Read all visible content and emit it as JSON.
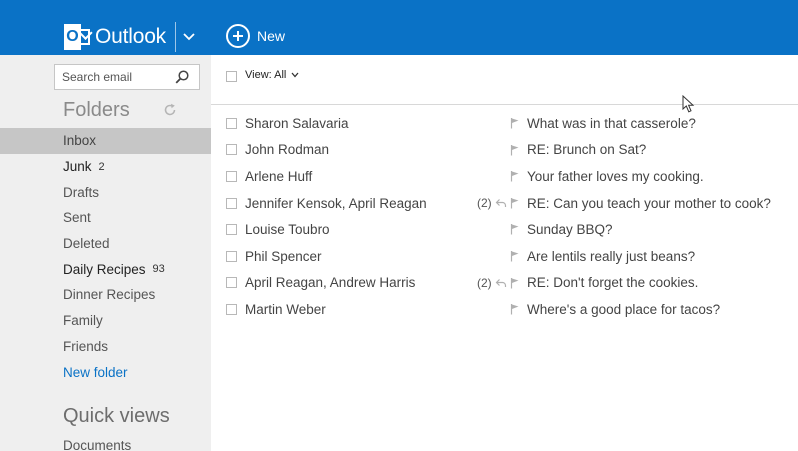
{
  "header": {
    "app_name": "Outlook",
    "new_label": "New",
    "brand_color": "#0a72c6"
  },
  "sidebar": {
    "search_placeholder": "Search email",
    "folders_title": "Folders",
    "folders": [
      {
        "label": "Inbox",
        "count": "",
        "state": "active"
      },
      {
        "label": "Junk",
        "count": "2",
        "state": "bold"
      },
      {
        "label": "Drafts",
        "count": "",
        "state": "normal"
      },
      {
        "label": "Sent",
        "count": "",
        "state": "normal"
      },
      {
        "label": "Deleted",
        "count": "",
        "state": "normal"
      },
      {
        "label": "Daily Recipes",
        "count": "93",
        "state": "bold"
      },
      {
        "label": "Dinner Recipes",
        "count": "",
        "state": "normal"
      },
      {
        "label": "Family",
        "count": "",
        "state": "normal"
      },
      {
        "label": "Friends",
        "count": "",
        "state": "normal"
      },
      {
        "label": "New folder",
        "count": "",
        "state": "link"
      }
    ],
    "quick_views_title": "Quick views",
    "quick_views": [
      {
        "label": "Documents"
      }
    ]
  },
  "toolbar": {
    "view_label": "View: All"
  },
  "messages": [
    {
      "sender": "Sharon Salavaria",
      "thread_count": "",
      "replied": false,
      "subject": "What was in that casserole?"
    },
    {
      "sender": "John Rodman",
      "thread_count": "",
      "replied": false,
      "subject": "RE: Brunch on Sat?"
    },
    {
      "sender": "Arlene Huff",
      "thread_count": "",
      "replied": false,
      "subject": "Your father loves my cooking."
    },
    {
      "sender": "Jennifer Kensok, April Reagan",
      "thread_count": "(2)",
      "replied": true,
      "subject": "RE: Can you teach your mother to cook?"
    },
    {
      "sender": "Louise Toubro",
      "thread_count": "",
      "replied": false,
      "subject": "Sunday BBQ?"
    },
    {
      "sender": "Phil Spencer",
      "thread_count": "",
      "replied": false,
      "subject": "Are lentils really just beans?"
    },
    {
      "sender": "April Reagan, Andrew Harris",
      "thread_count": "(2)",
      "replied": true,
      "subject": "RE: Don't forget the cookies."
    },
    {
      "sender": "Martin Weber",
      "thread_count": "",
      "replied": false,
      "subject": "Where's a good place for tacos?"
    }
  ],
  "icons": {
    "logo": "outlook-logo-icon",
    "app_switcher": "chevron-down-icon",
    "new": "plus-circle-icon",
    "search": "search-icon",
    "refresh": "refresh-icon",
    "view_dropdown": "chevron-down-icon",
    "flag": "flag-icon",
    "reply": "reply-icon",
    "cursor": "mouse-cursor-icon"
  }
}
